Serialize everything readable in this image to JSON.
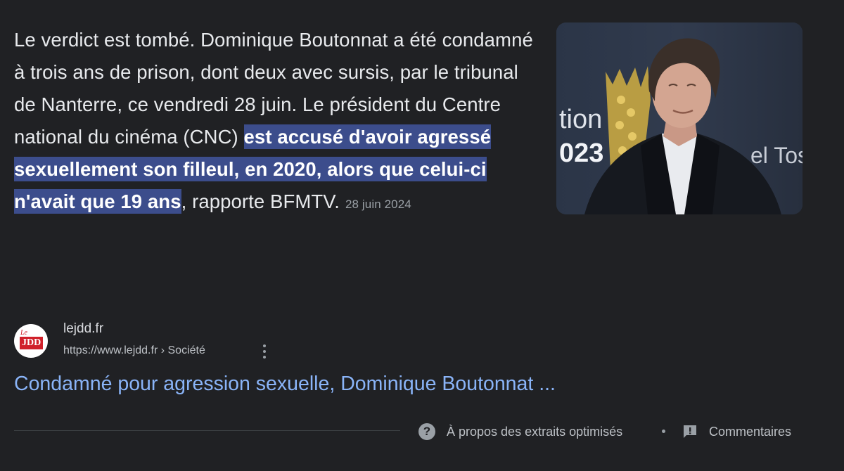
{
  "snippet": {
    "text_before": "Le verdict est tombé. Dominique Boutonnat a été condamné à trois ans de prison, dont deux avec sursis, par le tribunal de Nanterre, ce vendredi 28 juin. Le président du Centre national du cinéma (CNC) ",
    "highlight": "est accusé d'avoir agressé sexuellement son filleul, en 2020, alors que celui-ci n'avait que 19 ans",
    "text_after": ", rapporte BFMTV.",
    "date": "28 juin 2024"
  },
  "thumbnail": {
    "backdrop_text_left_top": "tion",
    "backdrop_text_left_bottom": "023",
    "backdrop_text_right": "el Tos"
  },
  "source": {
    "favicon_text_top": "Le",
    "favicon_text": "JDD",
    "site_name": "lejdd.fr",
    "url": "https://www.lejdd.fr › Société"
  },
  "result": {
    "title": "Condamné pour agression sexuelle, Dominique Boutonnat ..."
  },
  "footer": {
    "about_label": "À propos des extraits optimisés",
    "feedback_label": "Commentaires"
  },
  "colors": {
    "background": "#202124",
    "link": "#8ab4f8",
    "highlight": "#3c4d8c"
  },
  "icons": [
    "help-circle-icon",
    "more-vert-icon",
    "feedback-icon",
    "favicon-logo"
  ]
}
